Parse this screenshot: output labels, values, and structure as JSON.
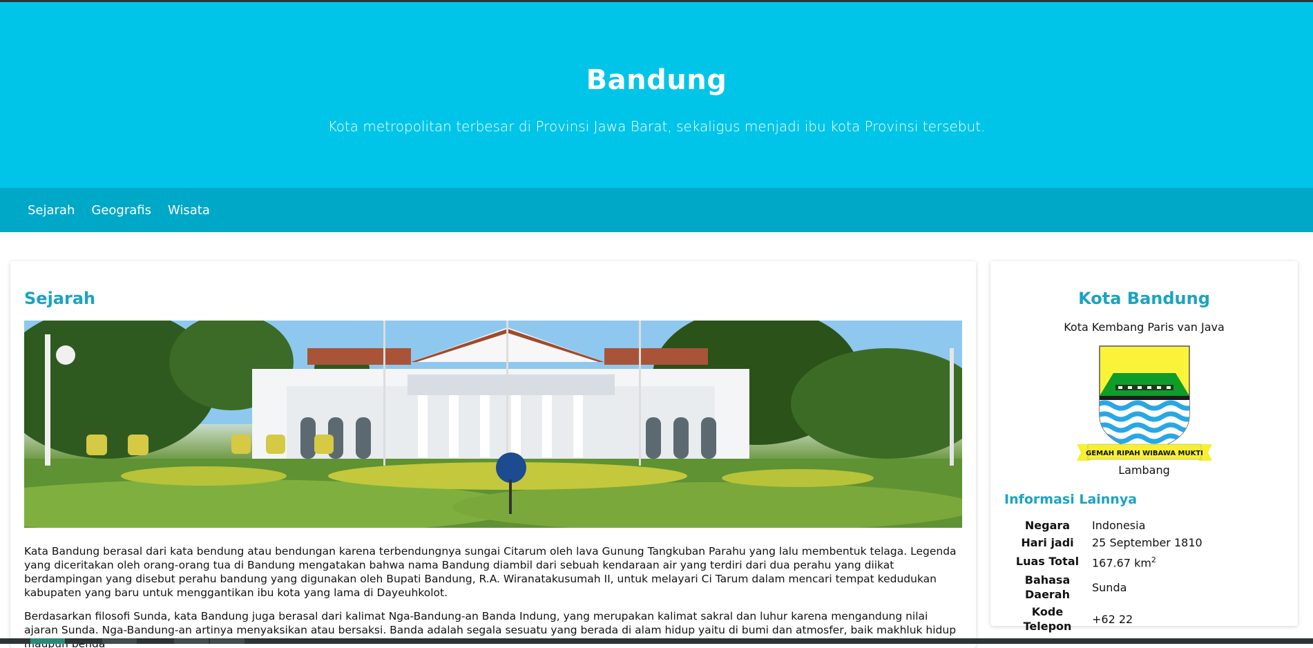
{
  "header": {
    "title": "Bandung",
    "tagline": "Kota metropolitan terbesar di Provinsi Jawa Barat, sekaligus menjadi ibu kota Provinsi tersebut."
  },
  "nav": {
    "items": [
      {
        "label": "Sejarah"
      },
      {
        "label": "Geografis"
      },
      {
        "label": "Wisata"
      }
    ]
  },
  "main": {
    "section_title": "Sejarah",
    "paragraphs": [
      "Kata Bandung berasal dari kata bendung atau bendungan karena terbendungnya sungai Citarum oleh lava Gunung Tangkuban Parahu yang lalu membentuk telaga. Legenda yang diceritakan oleh orang-orang tua di Bandung mengatakan bahwa nama Bandung diambil dari sebuah kendaraan air yang terdiri dari dua perahu yang diikat berdampingan yang disebut perahu bandung yang digunakan oleh Bupati Bandung, R.A. Wiranatakusumah II, untuk melayari Ci Tarum dalam mencari tempat kedudukan kabupaten yang baru untuk menggantikan ibu kota yang lama di Dayeuhkolot.",
      "Berdasarkan filosofi Sunda, kata Bandung juga berasal dari kalimat Nga-Bandung-an Banda Indung, yang merupakan kalimat sakral dan luhur karena mengandung nilai ajaran Sunda. Nga-Bandung-an artinya menyaksikan atau bersaksi. Banda adalah segala sesuatu yang berada di alam hidup yaitu di bumi dan atmosfer, baik makhluk hidup maupun benda"
    ]
  },
  "infobox": {
    "title": "Kota Bandung",
    "subtitle": "Kota Kembang Paris van Java",
    "emblem_motto": "GEMAH RIPAH WIBAWA MUKTI",
    "emblem_caption": "Lambang",
    "more_info_heading": "Informasi Lainnya",
    "rows": [
      {
        "key": "Negara",
        "value": "Indonesia"
      },
      {
        "key": "Hari jadi",
        "value": "25 September 1810"
      },
      {
        "key": "Luas Total",
        "value": "167.67 km",
        "sup": "2"
      },
      {
        "key": "Bahasa Daerah",
        "value": "Sunda"
      },
      {
        "key": "Kode Telepon",
        "value": "+62 22"
      }
    ]
  },
  "colors": {
    "header_bg": "#00c5e9",
    "nav_bg": "#00a8c8",
    "accent": "#1aa3c4"
  }
}
